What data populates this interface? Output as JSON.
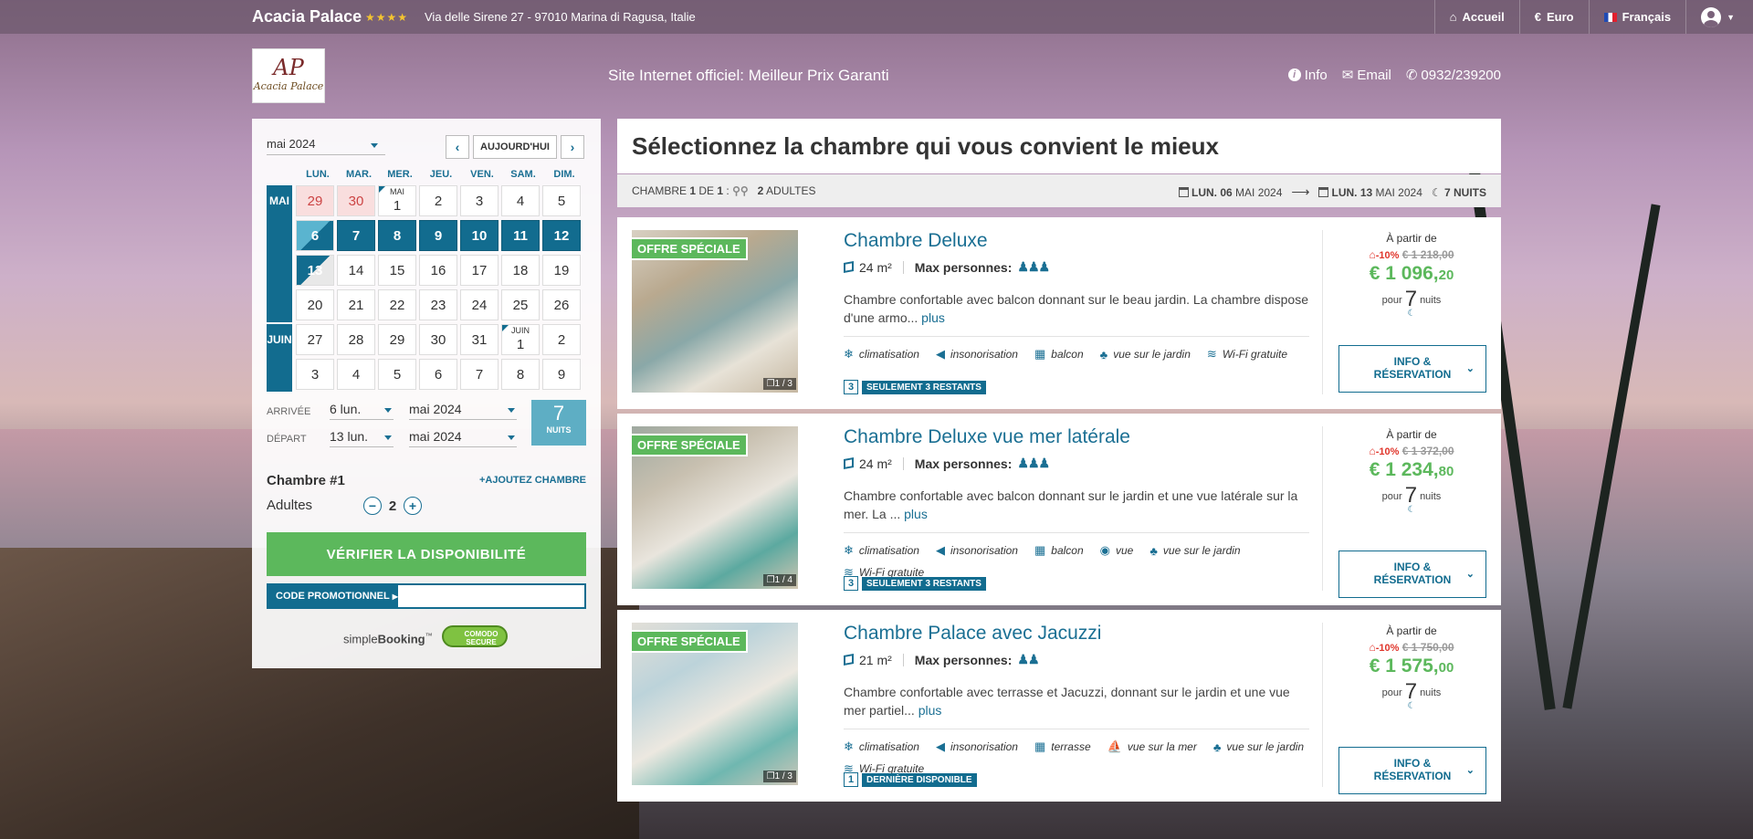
{
  "topbar": {
    "hotel_name": "Acacia Palace",
    "stars": "★★★★",
    "address": "Via delle Sirene 27 - 97010 Marina di Ragusa, Italie",
    "nav": {
      "home": "Accueil",
      "currency": "Euro",
      "language": "Français"
    }
  },
  "header": {
    "logo_mono": "AP",
    "logo_name": "Acacia Palace",
    "slogan": "Site Internet officiel: Meilleur Prix Garanti",
    "info": "Info",
    "email": "Email",
    "phone": "0932/239200"
  },
  "booking": {
    "month_select": "mai 2024",
    "today_label": "AUJOURD'HUI",
    "weekdays": [
      "LUN.",
      "MAR.",
      "MER.",
      "JEU.",
      "VEN.",
      "SAM.",
      "DIM."
    ],
    "month_mai": "MAI",
    "month_juin": "JUIN",
    "mini_mai": "MAI",
    "mini_juin": "JUIN",
    "weeks": [
      [
        "29",
        "30",
        "1",
        "2",
        "3",
        "4",
        "5"
      ],
      [
        "6",
        "7",
        "8",
        "9",
        "10",
        "11",
        "12"
      ],
      [
        "13",
        "14",
        "15",
        "16",
        "17",
        "18",
        "19"
      ],
      [
        "20",
        "21",
        "22",
        "23",
        "24",
        "25",
        "26"
      ],
      [
        "27",
        "28",
        "29",
        "30",
        "31",
        "1",
        "2"
      ],
      [
        "3",
        "4",
        "5",
        "6",
        "7",
        "8",
        "9"
      ]
    ],
    "arrival_label": "ARRIVÉE",
    "arrival_day": "6 lun.",
    "arrival_month": "mai 2024",
    "departure_label": "DÉPART",
    "departure_day": "13 lun.",
    "departure_month": "mai 2024",
    "nights_count": "7",
    "nights_label": "NUITS",
    "room_label": "Chambre #1",
    "add_room": "AJOUTEZ CHAMBRE",
    "adults_label": "Adultes",
    "adults_value": "2",
    "verify_button": "VÉRIFIER LA DISPONIBILITÉ",
    "promo_label": "CODE PROMOTIONNEL",
    "promo_value": "",
    "powered_a": "simple",
    "powered_b": "Booking",
    "powered_c": "™",
    "secure_top": "COMODO",
    "secure_bottom": "SECURE"
  },
  "main": {
    "title": "Sélectionnez la chambre qui vous convient le mieux",
    "summary": {
      "room_a": "CHAMBRE ",
      "room_n": "1",
      "room_b": " DE ",
      "room_m": "1",
      "room_c": " :",
      "adults_n": "2",
      "adults_t": " ADULTES",
      "checkin_day": "LUN. 06",
      "checkin_month": " MAI 2024",
      "checkout_day": "LUN. 13",
      "checkout_month": " MAI 2024",
      "nights": "7 NUITS"
    },
    "rooms": [
      {
        "badge": "OFFRE SPÉCIALE",
        "img_count": "1 / 3",
        "name": "Chambre Deluxe",
        "size": "24 m²",
        "max_label": "Max personnes:",
        "persons": "3",
        "desc": "Chambre confortable avec balcon donnant sur le beau jardin. La chambre dispose d'une armo...",
        "more": "plus",
        "amenities": [
          "climatisation",
          "insonorisation",
          "balcon",
          "vue sur le jardin",
          "Wi-Fi gratuite"
        ],
        "avail_num": "3",
        "avail_text": "SEULEMENT 3 RESTANTS",
        "from": "À partir de",
        "discount": "-10%",
        "old_price": "€ 1 218,00",
        "price_int": "€ 1 096,",
        "price_dec": "20",
        "pour": "pour",
        "nights": "7",
        "nuits": "nuits",
        "btn_l1": "INFO &",
        "btn_l2": "RÉSERVATION"
      },
      {
        "badge": "OFFRE SPÉCIALE",
        "img_count": "1 / 4",
        "name": "Chambre Deluxe vue mer latérale",
        "size": "24 m²",
        "max_label": "Max personnes:",
        "persons": "3",
        "desc": "Chambre confortable avec balcon donnant sur le jardin et une vue latérale sur la mer. La ...",
        "more": "plus",
        "amenities": [
          "climatisation",
          "insonorisation",
          "balcon",
          "vue",
          "vue sur le jardin",
          "Wi-Fi gratuite"
        ],
        "avail_num": "3",
        "avail_text": "SEULEMENT 3 RESTANTS",
        "from": "À partir de",
        "discount": "-10%",
        "old_price": "€ 1 372,00",
        "price_int": "€ 1 234,",
        "price_dec": "80",
        "pour": "pour",
        "nights": "7",
        "nuits": "nuits",
        "btn_l1": "INFO &",
        "btn_l2": "RÉSERVATION"
      },
      {
        "badge": "OFFRE SPÉCIALE",
        "img_count": "1 / 3",
        "name": "Chambre Palace avec Jacuzzi",
        "size": "21 m²",
        "max_label": "Max personnes:",
        "persons": "2",
        "desc": "Chambre confortable avec terrasse et Jacuzzi, donnant sur le jardin et une vue mer partiel...",
        "more": "plus",
        "amenities": [
          "climatisation",
          "insonorisation",
          "terrasse",
          "vue sur la mer",
          "vue sur le jardin",
          "Wi-Fi gratuite"
        ],
        "avail_num": "1",
        "avail_text": "DERNIÈRE DISPONIBLE",
        "from": "À partir de",
        "discount": "-10%",
        "old_price": "€ 1 750,00",
        "price_int": "€ 1 575,",
        "price_dec": "00",
        "pour": "pour",
        "nights": "7",
        "nuits": "nuits",
        "btn_l1": "INFO &",
        "btn_l2": "RÉSERVATION"
      }
    ]
  },
  "colors": {
    "accent": "#126c8f",
    "green": "#5cb85c",
    "discount": "#e0362c"
  }
}
